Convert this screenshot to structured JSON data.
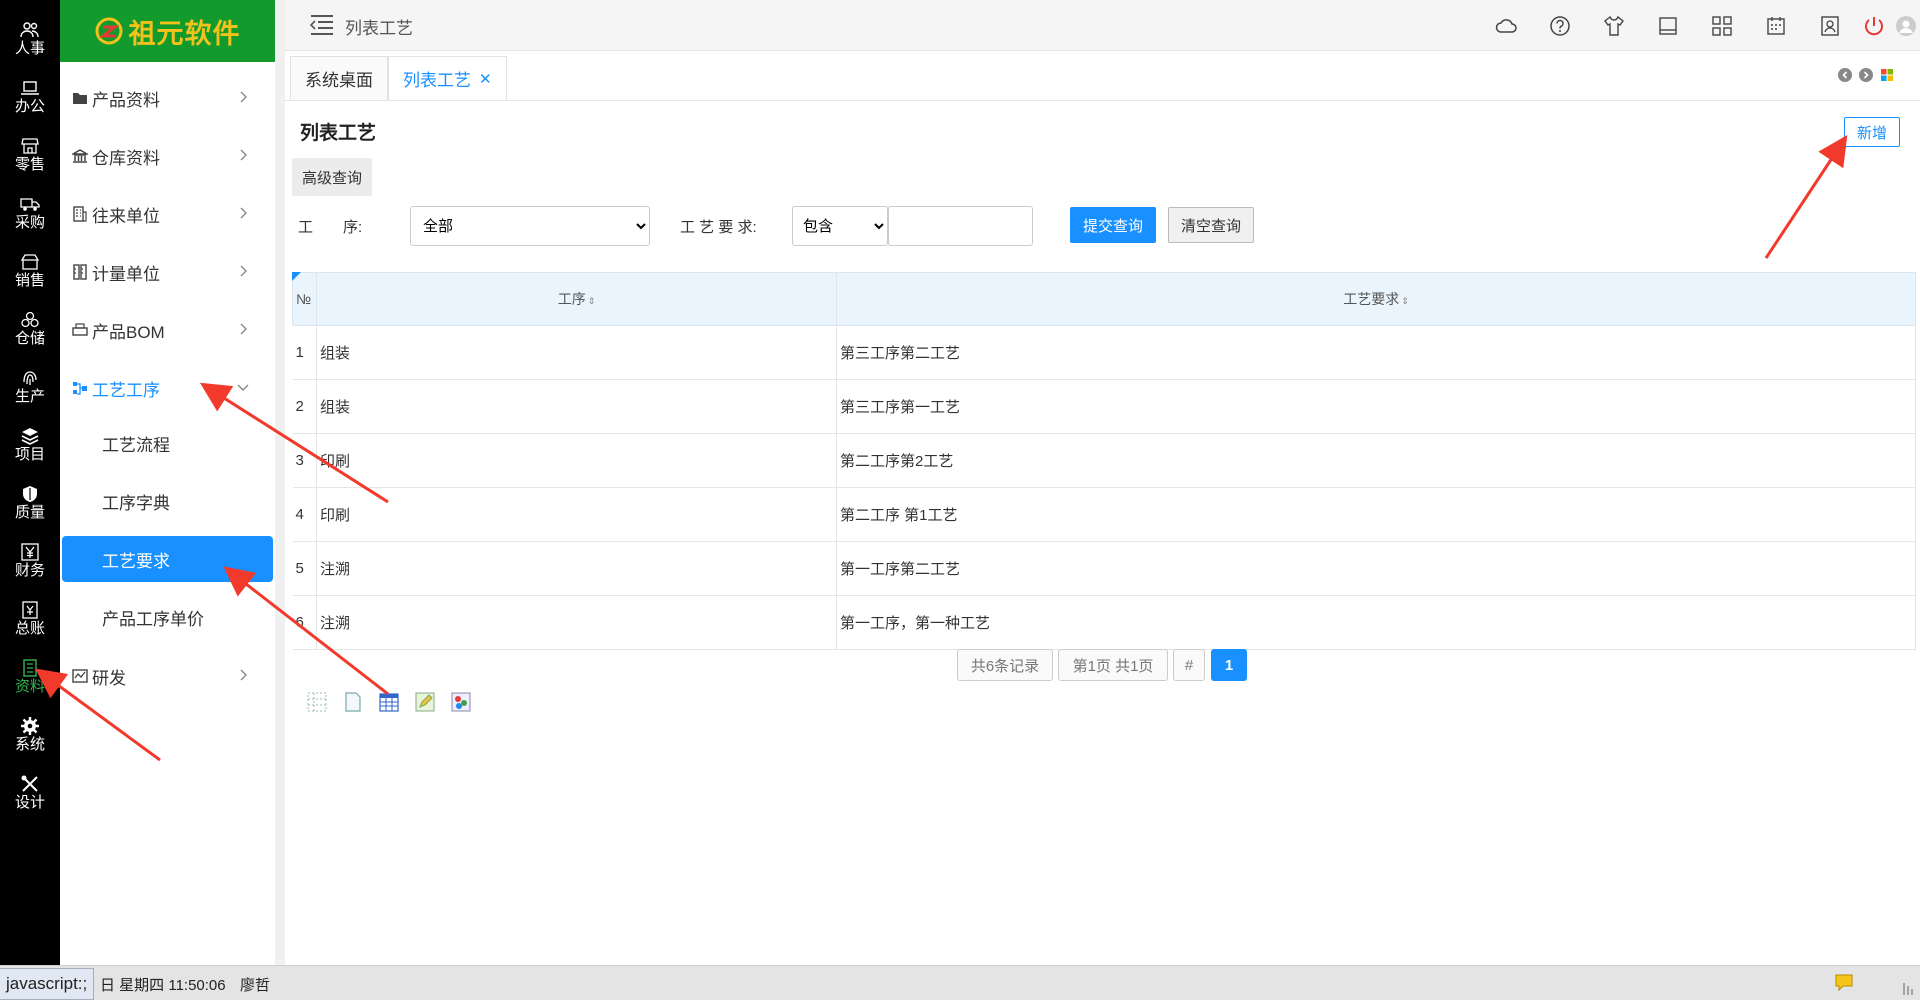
{
  "iconbar": {
    "items": [
      {
        "label": "人事",
        "icon": "users-icon"
      },
      {
        "label": "办公",
        "icon": "laptop-icon"
      },
      {
        "label": "零售",
        "icon": "store-icon"
      },
      {
        "label": "采购",
        "icon": "truck-icon"
      },
      {
        "label": "销售",
        "icon": "shop-icon"
      },
      {
        "label": "仓储",
        "icon": "boxes-icon"
      },
      {
        "label": "生产",
        "icon": "fingerprint-icon"
      },
      {
        "label": "项目",
        "icon": "layers-icon"
      },
      {
        "label": "质量",
        "icon": "shield-icon"
      },
      {
        "label": "财务",
        "icon": "yen-icon"
      },
      {
        "label": "总账",
        "icon": "ledger-icon"
      },
      {
        "label": "资料",
        "icon": "document-icon",
        "active": true
      },
      {
        "label": "系统",
        "icon": "gear-icon"
      },
      {
        "label": "设计",
        "icon": "tools-icon"
      }
    ]
  },
  "logo": {
    "text": "祖元软件"
  },
  "menu": {
    "groups": [
      {
        "label": "产品资料",
        "icon": "folder-icon"
      },
      {
        "label": "仓库资料",
        "icon": "bank-icon"
      },
      {
        "label": "往来单位",
        "icon": "building-icon"
      },
      {
        "label": "计量单位",
        "icon": "ruler-icon"
      },
      {
        "label": "产品BOM",
        "icon": "printer-icon"
      },
      {
        "label": "工艺工序",
        "icon": "nodes-icon",
        "open": true
      },
      {
        "label": "研发",
        "icon": "chart-icon"
      }
    ],
    "subitems": [
      {
        "label": "工艺流程"
      },
      {
        "label": "工序字典"
      },
      {
        "label": "工艺要求",
        "active": true
      },
      {
        "label": "产品工序单价"
      }
    ]
  },
  "topbar": {
    "title": "列表工艺"
  },
  "tabs": [
    {
      "label": "系统桌面"
    },
    {
      "label": "列表工艺",
      "active": true,
      "close": "✕"
    }
  ],
  "page": {
    "title": "列表工艺",
    "add_label": "新增"
  },
  "search": {
    "title": "高级查询",
    "op_label": "工　　序:",
    "op_value": "全部",
    "req_label": "工 艺 要 求:",
    "req_mode": "包含",
    "req_value": "",
    "submit_label": "提交查询",
    "clear_label": "清空查询"
  },
  "table": {
    "headers": {
      "num": "№",
      "op": "工序",
      "req": "工艺要求"
    },
    "rows": [
      {
        "num": "1",
        "op": "组装",
        "req": "第三工序第二工艺"
      },
      {
        "num": "2",
        "op": "组装",
        "req": "第三工序第一工艺"
      },
      {
        "num": "3",
        "op": "印刷",
        "req": "第二工序第2工艺"
      },
      {
        "num": "4",
        "op": "印刷",
        "req": "第二工序 第1工艺"
      },
      {
        "num": "5",
        "op": "注溯",
        "req": "第一工序第二工艺"
      },
      {
        "num": "6",
        "op": "注溯",
        "req": "第一工序，第一种工艺"
      }
    ]
  },
  "pager": {
    "total": "共6条记录",
    "pages": "第1页 共1页",
    "hash": "#",
    "current": "1"
  },
  "statusbar": {
    "url": "javascript:;",
    "time": "日 星期四 11:50:06",
    "user": "廖哲"
  },
  "colors": {
    "accent": "#1890ff",
    "logo_bg": "#139a2c",
    "logo_text": "#f1c11c",
    "active_green": "#31b54a",
    "arrow_red": "#f23a2c"
  }
}
